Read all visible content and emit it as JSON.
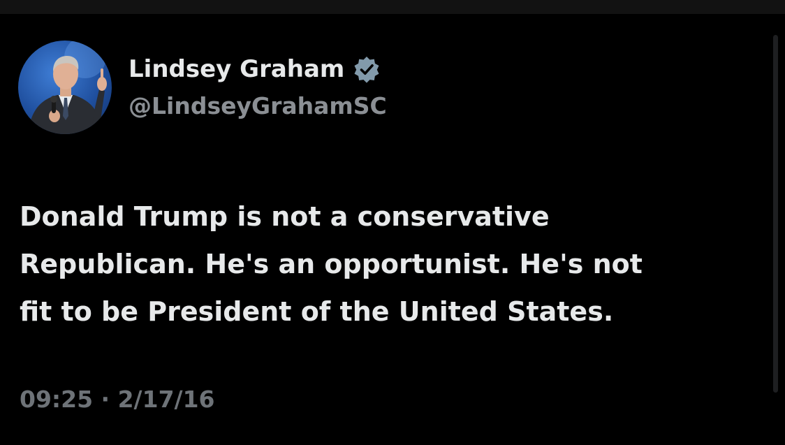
{
  "tweet": {
    "author": {
      "display_name": "Lindsey Graham",
      "handle": "@LindseyGrahamSC",
      "verified_icon": "verified-badge-icon",
      "avatar_icon": "profile-photo"
    },
    "text_lines": [
      "Donald Trump is not a conservative",
      "Republican. He's an opportunist. He's not",
      "fit to be President of the United States."
    ],
    "time": "09:25",
    "separator": "·",
    "date": "2/17/16"
  },
  "colors": {
    "background": "#000000",
    "text_primary": "#e7e9ea",
    "text_secondary": "#8b8f94",
    "verified_badge": "#829aab"
  }
}
